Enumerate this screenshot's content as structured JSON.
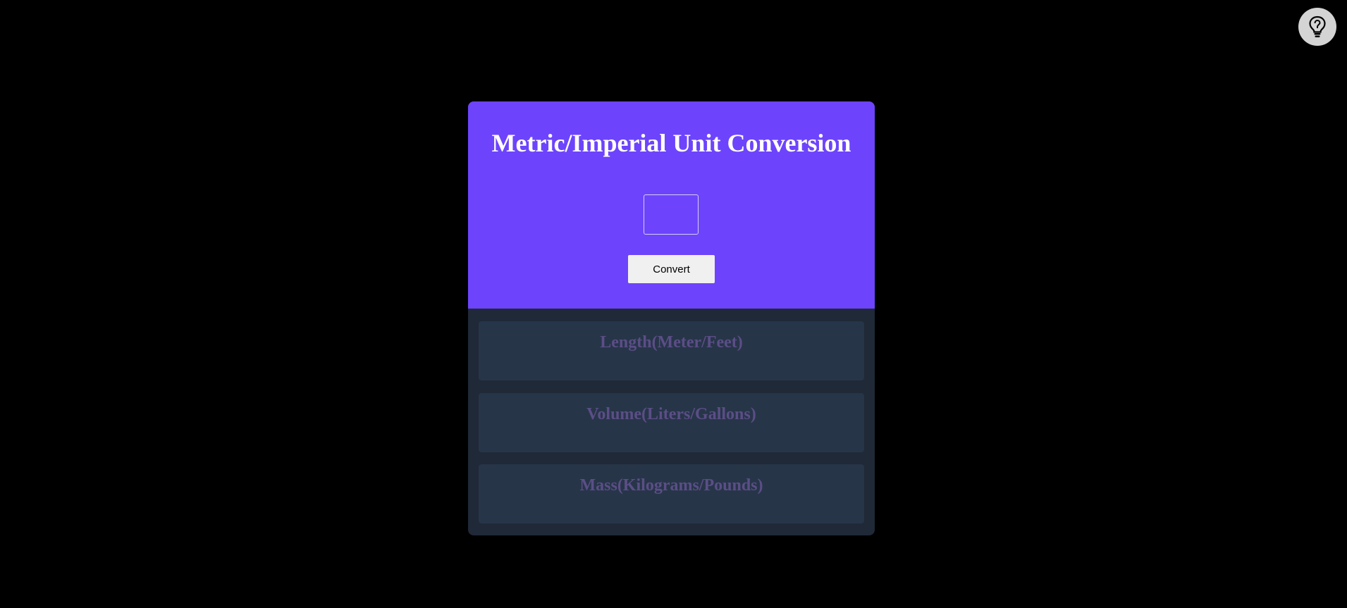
{
  "toolbar": {
    "theme_toggle_icon": "lightbulb-icon"
  },
  "converter": {
    "title": "Metric/Imperial Unit Conversion",
    "input_value": "",
    "input_placeholder": "",
    "convert_label": "Convert"
  },
  "results": {
    "length_title": "Length(Meter/Feet)",
    "volume_title": "Volume(Liters/Gallons)",
    "mass_title": "Mass(Kilograms/Pounds)"
  },
  "colors": {
    "background": "#000000",
    "header_purple": "#6d44fc",
    "card_dark": "#1f2937",
    "result_box": "#273549",
    "result_text": "#5b4e86"
  }
}
